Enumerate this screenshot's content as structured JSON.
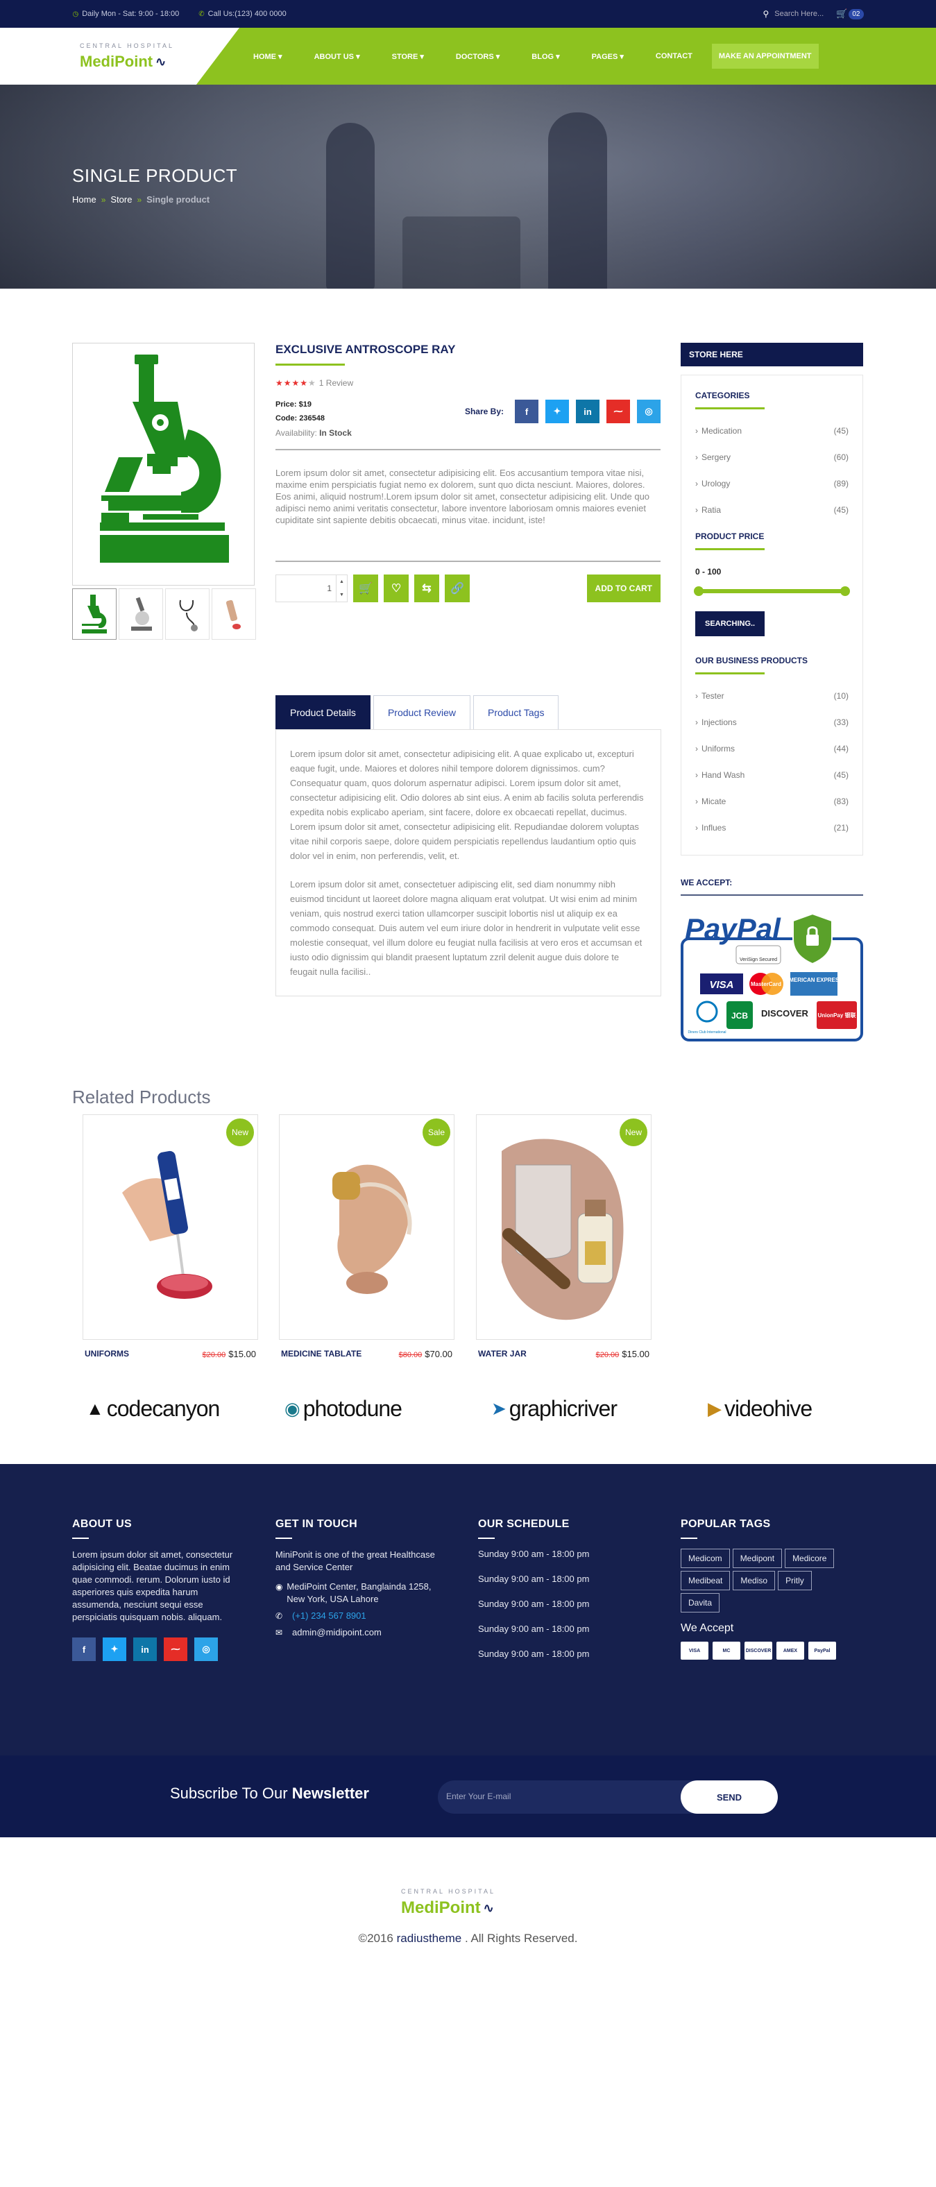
{
  "topbar": {
    "hours": "Daily Mon - Sat: 9:00 - 18:00",
    "phone": "Call Us:(123) 400 0000",
    "search_placeholder": "Search Here...",
    "cart_count": "02"
  },
  "logo": {
    "name": "MediPoint",
    "tagline": "CENTRAL HOSPITAL"
  },
  "nav": {
    "items": [
      "HOME",
      "ABOUT US",
      "STORE",
      "DOCTORS",
      "BLOG",
      "PAGES",
      "CONTACT"
    ],
    "appointment": "MAKE AN APPOINTMENT"
  },
  "banner": {
    "title": "SINGLE PRODUCT",
    "breadcrumb": [
      "Home",
      "Store",
      "Single product"
    ]
  },
  "product": {
    "title": "EXCLUSIVE ANTROSCOPE RAY",
    "rating": 4,
    "review_text": "1 Review",
    "price_label": "Price:",
    "price": "$19",
    "code_label": "Code:",
    "code": "236548",
    "availability_label": "Availability:",
    "availability": "In Stock",
    "share_label": "Share By:",
    "description": "Lorem ipsum dolor sit amet, consectetur adipisicing elit. Eos accusantium tempora vitae nisi, maxime enim perspiciatis fugiat nemo ex dolorem, sunt quo dicta nesciunt. Maiores, dolores. Eos animi, aliquid nostrum!.Lorem ipsum dolor sit amet, consectetur adipisicing elit. Unde quo adipisci nemo animi veritatis consectetur, labore inventore laboriosam omnis maiores eveniet cupiditate sint sapiente debitis obcaecati, minus vitae. incidunt, iste!",
    "quantity": "1",
    "add_to_cart": "ADD TO CART"
  },
  "tabs": {
    "labels": [
      "Product Details",
      "Product Review",
      "Product Tags"
    ],
    "para1": "Lorem ipsum dolor sit amet, consectetur adipisicing elit. A quae explicabo ut, excepturi eaque fugit, unde. Maiores et dolores nihil tempore dolorem dignissimos. cum? Consequatur quam, quos dolorum aspernatur adipisci. Lorem ipsum dolor sit amet, consectetur adipisicing elit. Odio dolores ab sint eius. A enim ab facilis soluta perferendis expedita nobis explicabo aperiam, sint facere, dolore ex obcaecati repellat, ducimus. Lorem ipsum dolor sit amet, consectetur adipisicing elit. Repudiandae dolorem voluptas vitae nihil corporis saepe, dolore quidem perspiciatis repellendus laudantium optio quis dolor vel in enim, non perferendis, velit, et.",
    "para2": "Lorem ipsum dolor sit amet, consectetuer adipiscing elit, sed diam nonummy nibh euismod tincidunt ut laoreet dolore magna aliquam erat volutpat. Ut wisi enim ad minim veniam, quis nostrud exerci tation ullamcorper suscipit lobortis nisl ut aliquip ex ea commodo consequat. Duis autem vel eum iriure dolor in hendrerit in vulputate velit esse molestie consequat, vel illum dolore eu feugiat nulla facilisis at vero eros et accumsan et iusto odio dignissim qui blandit praesent luptatum zzril delenit augue duis dolore te feugait nulla facilisi.."
  },
  "sidebar": {
    "store_title": "STORE HERE",
    "categories_title": "CATEGORIES",
    "categories": [
      {
        "name": "Medication",
        "count": "(45)"
      },
      {
        "name": "Sergery",
        "count": "(60)"
      },
      {
        "name": "Urology",
        "count": "(89)"
      },
      {
        "name": "Ratia",
        "count": "(45)"
      }
    ],
    "price_title": "PRODUCT PRICE",
    "price_range": "0 - 100",
    "search_button": "SEARCHING..",
    "business_title": "OUR BUSINESS PRODUCTS",
    "business": [
      {
        "name": "Tester",
        "count": "(10)"
      },
      {
        "name": "Injections",
        "count": "(33)"
      },
      {
        "name": "Uniforms",
        "count": "(44)"
      },
      {
        "name": "Hand Wash",
        "count": "(45)"
      },
      {
        "name": "Micate",
        "count": "(83)"
      },
      {
        "name": "Influes",
        "count": "(21)"
      }
    ],
    "accept_title": "WE ACCEPT:",
    "paypal_word": "PayPal",
    "paypal_cards": [
      "VISA",
      "MasterCard",
      "AMERICAN EXPRESS",
      "Diners Club International",
      "JCB",
      "DISCOVER",
      "UnionPay 银联"
    ],
    "verisign": "VeriSign Secured"
  },
  "related": {
    "title": "Related Products",
    "items": [
      {
        "name": "UNIFORMS",
        "old": "$20.00",
        "price": "$15.00",
        "badge": "New"
      },
      {
        "name": "MEDICINE TABLATE",
        "old": "$80.00",
        "price": "$70.00",
        "badge": "Sale"
      },
      {
        "name": "WATER JAR",
        "old": "$20.00",
        "price": "$15.00",
        "badge": "New"
      }
    ]
  },
  "brands": [
    "codecanyon",
    "photodune",
    "graphicriver",
    "videohive"
  ],
  "footer": {
    "about_title": "ABOUT US",
    "about_text": "Lorem ipsum dolor sit amet, consectetur adipisicing elit. Beatae ducimus in enim quae commodi. rerum. Dolorum iusto id asperiores quis expedita harum assumenda, nesciunt sequi esse perspiciatis quisquam nobis. aliquam.",
    "touch_title": "GET IN TOUCH",
    "touch_text": "MiniPonit is one of the great Healthcase and Service Center",
    "address": "MediPoint Center, Banglainda 1258, New York, USA Lahore",
    "phone": "(+1) 234 567 8901",
    "email": "admin@midipoint.com",
    "schedule_title": "OUR SCHEDULE",
    "schedule": [
      "Sunday 9:00 am - 18:00 pm",
      "Sunday 9:00 am - 18:00 pm",
      "Sunday 9:00 am - 18:00 pm",
      "Sunday 9:00 am - 18:00 pm",
      "Sunday 9:00 am - 18:00 pm"
    ],
    "tags_title": "POPULAR TAGS",
    "tags": [
      "Medicom",
      "Medipont",
      "Medicore",
      "Medibeat",
      "Mediso",
      "Pritly",
      "Davita"
    ],
    "accept_title": "We Accept",
    "cards": [
      "VISA",
      "MC",
      "DISCOVER",
      "AMEX",
      "PayPal"
    ]
  },
  "newsletter": {
    "title_a": "Subscribe To Our",
    "title_b": "Newsletter",
    "placeholder": "Enter Your E-mail",
    "send": "SEND"
  },
  "copyright": {
    "prefix": "©2016",
    "link": "radiustheme",
    "suffix": ". All Rights Reserved."
  },
  "colors": {
    "navy": "#0f1a4d",
    "green": "#8dc21f",
    "facebook": "#3b5998",
    "twitter": "#1da1f2",
    "linkedin": "#0e76a8",
    "rss": "#e52d27",
    "dribbble": "#2ca3e8"
  }
}
